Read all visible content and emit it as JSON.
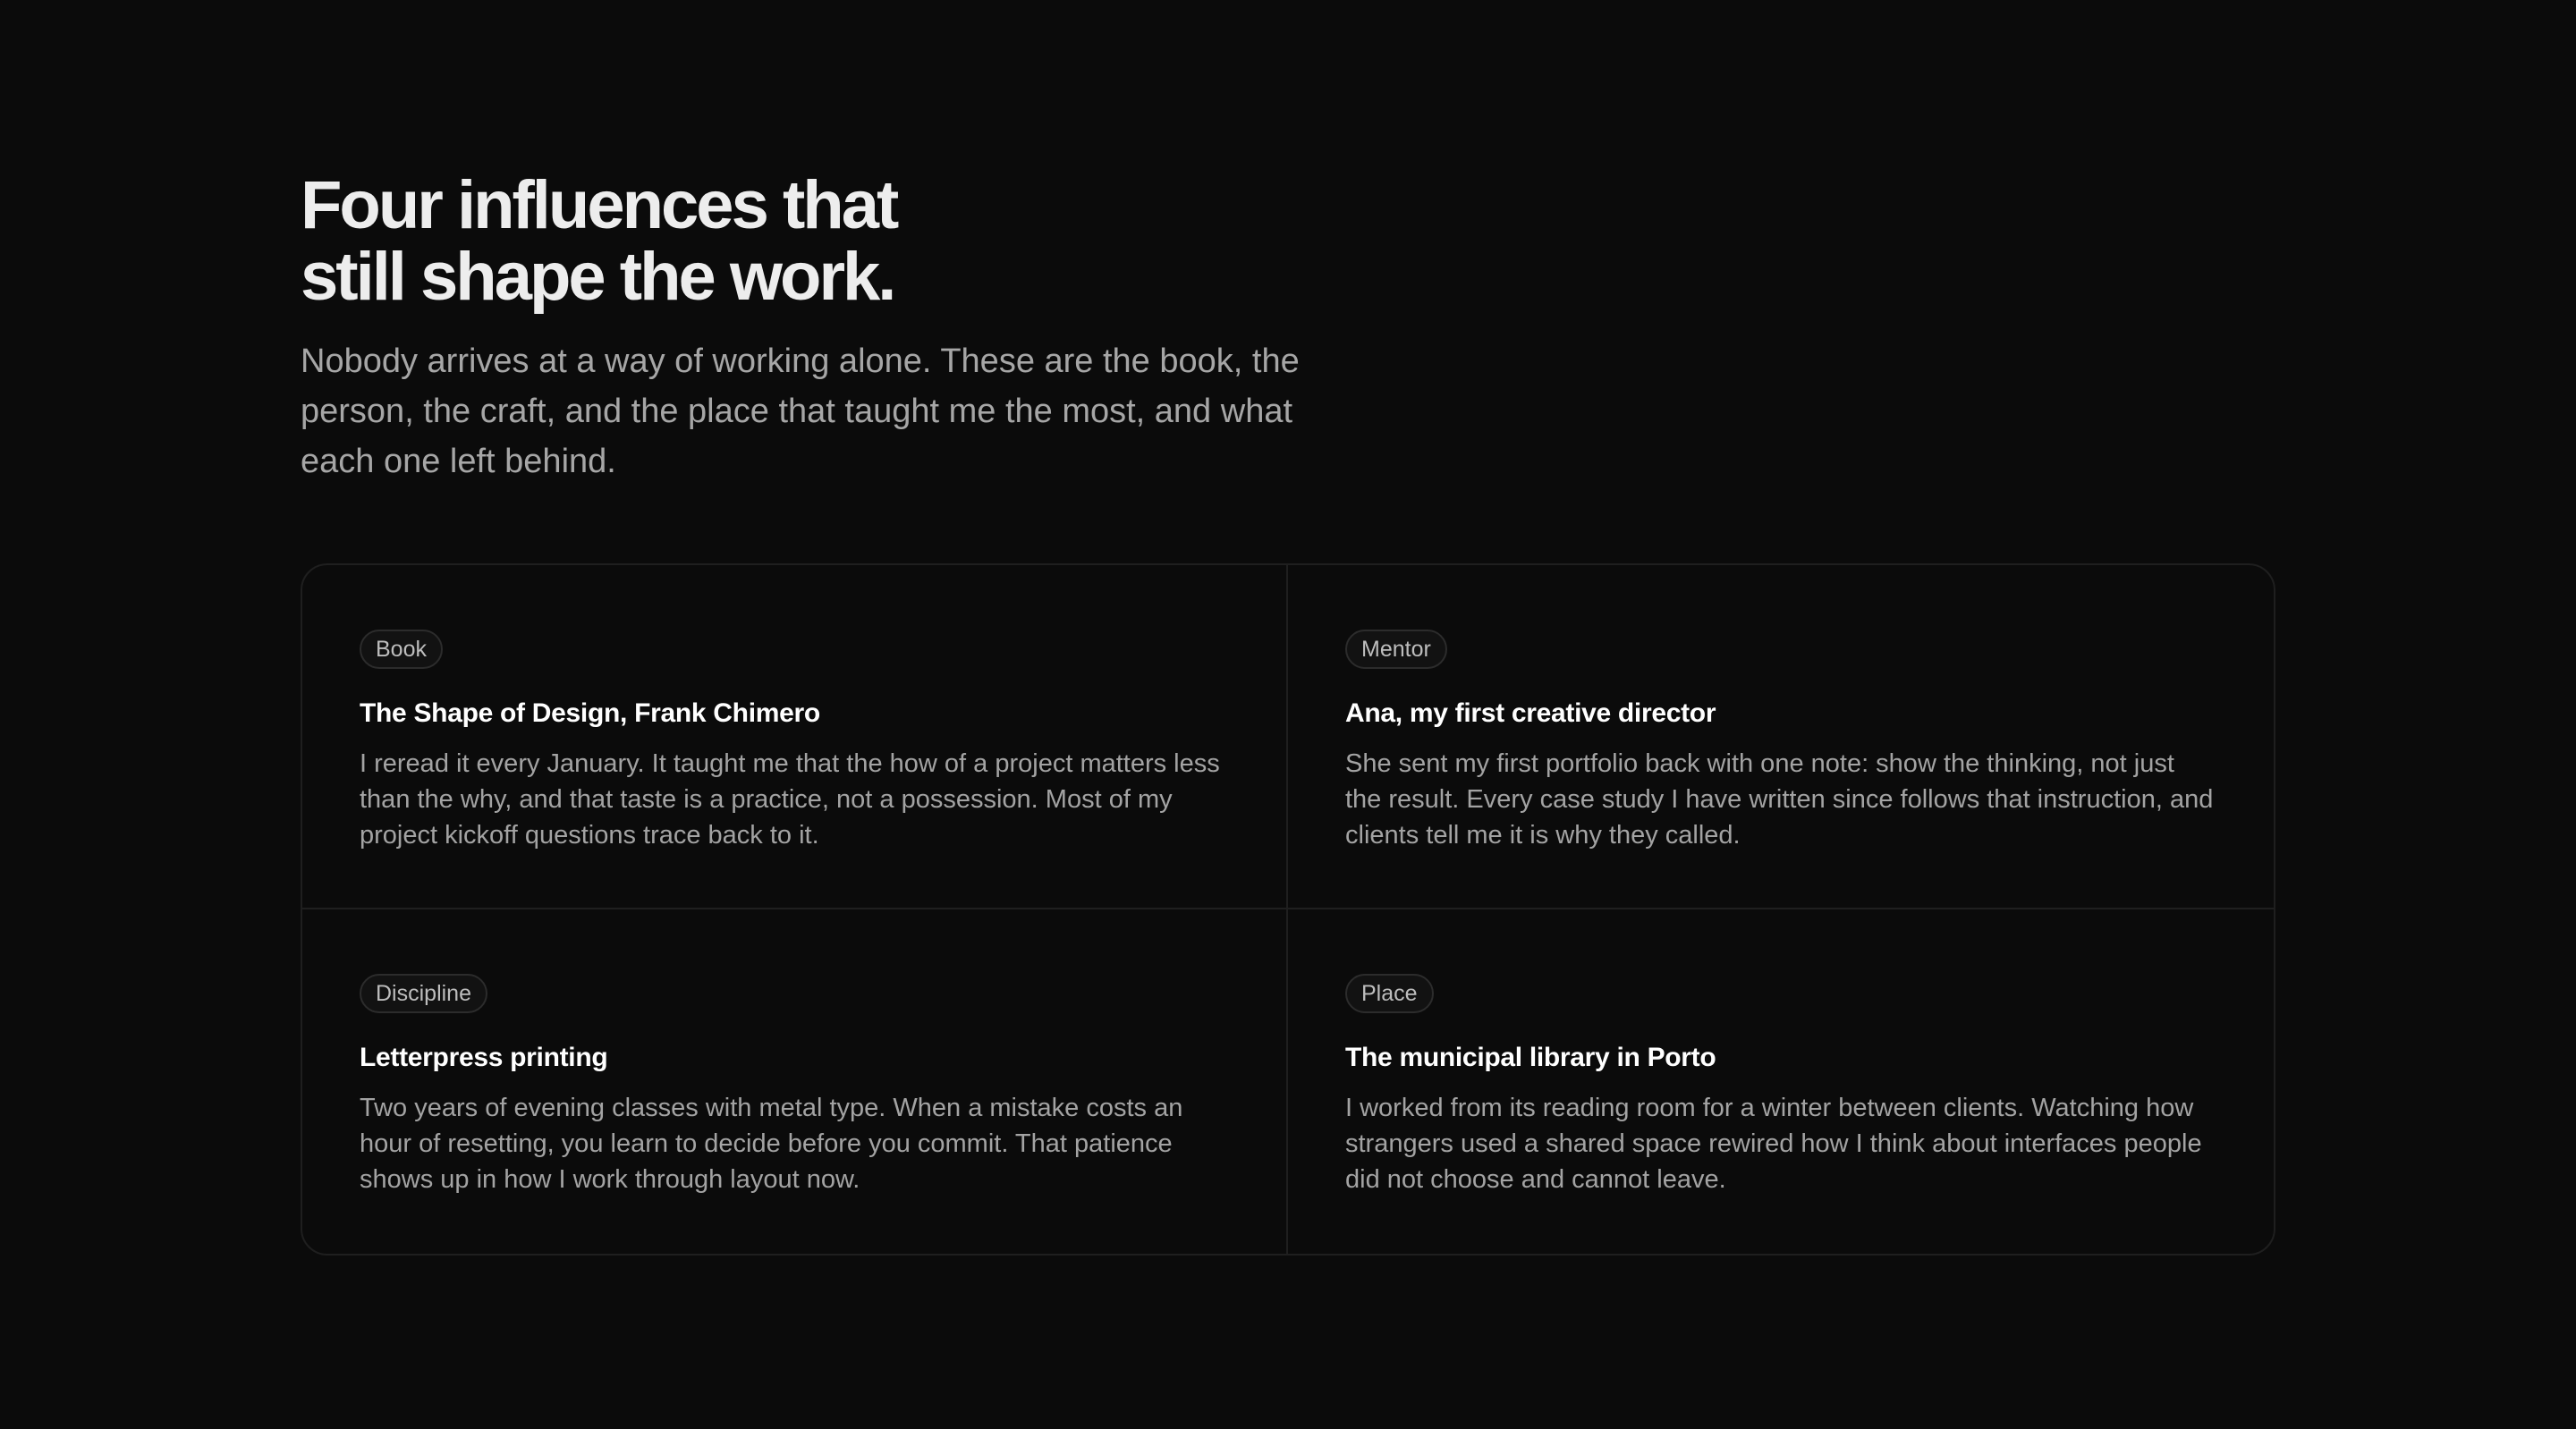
{
  "header": {
    "heading_line1": "Four influences that",
    "heading_line2": "still shape the work.",
    "intro": "Nobody arrives at a way of working alone. These are the book, the person, the craft, and the place that taught me the most, and what each one left behind."
  },
  "influences": [
    {
      "tag": "Book",
      "title": "The Shape of Design, Frank Chimero",
      "body": "I reread it every January. It taught me that the how of a project matters less than the why, and that taste is a practice, not a possession. Most of my project kickoff questions trace back to it."
    },
    {
      "tag": "Mentor",
      "title": "Ana, my first creative director",
      "body": "She sent my first portfolio back with one note: show the thinking, not just the result. Every case study I have written since follows that instruction, and clients tell me it is why they called."
    },
    {
      "tag": "Discipline",
      "title": "Letterpress printing",
      "body": "Two years of evening classes with metal type. When a mistake costs an hour of resetting, you learn to decide before you commit. That patience shows up in how I work through layout now."
    },
    {
      "tag": "Place",
      "title": "The municipal library in Porto",
      "body": "I worked from its reading room for a winter between clients. Watching how strangers used a shared space rewired how I think about interfaces people did not choose and cannot leave."
    }
  ],
  "colors": {
    "background": "#0b0b0b",
    "heading": "#ededed",
    "body_text": "#a3a3a3",
    "border": "#1f1f1f"
  }
}
